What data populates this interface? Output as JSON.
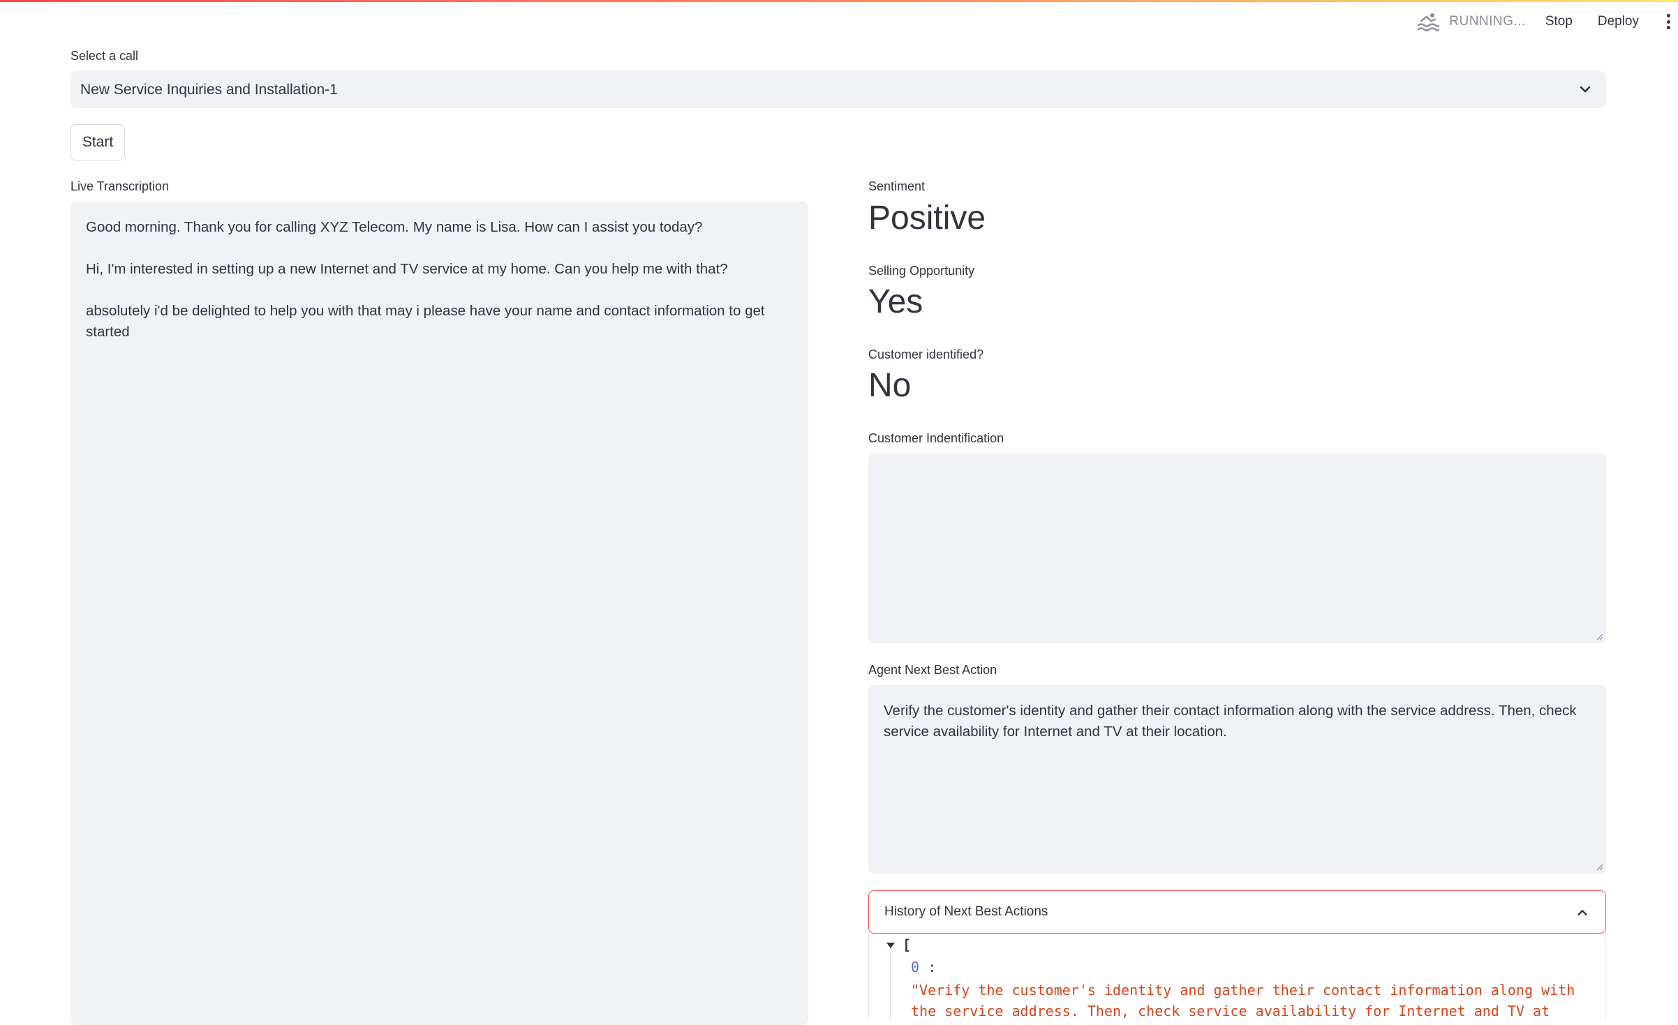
{
  "toolbar": {
    "status": "RUNNING...",
    "stop_label": "Stop",
    "deploy_label": "Deploy",
    "menu_icon": "kebab-menu-icon",
    "status_icon": "swimmer-icon"
  },
  "select_call": {
    "label": "Select a call",
    "value": "New Service Inquiries and Installation-1"
  },
  "start_label": "Start",
  "transcription": {
    "label": "Live Transcription",
    "lines": [
      "Good morning. Thank you for calling XYZ Telecom. My name is Lisa. How can I assist you today?",
      "Hi, I'm interested in setting up a new Internet and TV service at my home. Can you help me with that?",
      "absolutely i'd be delighted to help you with that may i please have your name and contact information to get started"
    ]
  },
  "metrics": {
    "sentiment": {
      "label": "Sentiment",
      "value": "Positive"
    },
    "selling_opportunity": {
      "label": "Selling Opportunity",
      "value": "Yes"
    },
    "customer_identified": {
      "label": "Customer identified?",
      "value": "No"
    }
  },
  "customer_identification": {
    "label": "Customer Indentification",
    "value": ""
  },
  "next_best_action": {
    "label": "Agent Next Best Action",
    "value": "Verify the customer's identity and gather their contact information along with the service address. Then, check service availability for Internet and TV at their location."
  },
  "history": {
    "label": "History of Next Best Actions",
    "open_bracket": "[",
    "items": [
      {
        "index": "0",
        "text": "\"Verify the customer's identity and gather their contact information along with the service address. Then, check service availability for Internet and TV at their"
      }
    ]
  },
  "colors": {
    "accent": "#ff4b4b",
    "input_bg": "#f0f2f6",
    "text": "#31333f",
    "json_string": "#d6451a",
    "json_key": "#5b6ec9"
  }
}
